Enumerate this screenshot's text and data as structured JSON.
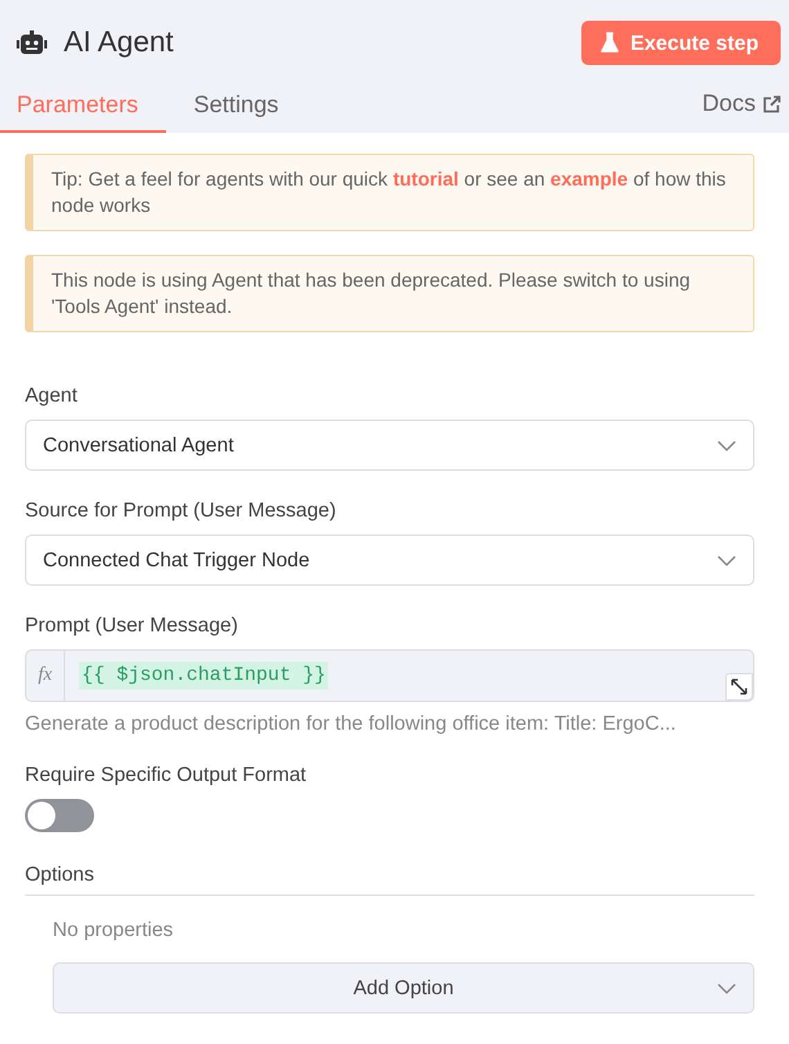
{
  "header": {
    "title": "AI Agent",
    "execute_button": "Execute step"
  },
  "tabs": [
    {
      "label": "Parameters",
      "selected": true
    },
    {
      "label": "Settings",
      "selected": false
    }
  ],
  "docs_link": "Docs",
  "notices": [
    {
      "parts": [
        {
          "text": "Tip: Get a feel for agents with our quick ",
          "link": false
        },
        {
          "text": "tutorial",
          "link": true
        },
        {
          "text": " or see an ",
          "link": false
        },
        {
          "text": "example",
          "link": true
        },
        {
          "text": " of how this node works",
          "link": false
        }
      ]
    },
    {
      "parts": [
        {
          "text": "This node is using Agent that has been deprecated. Please switch to using 'Tools Agent' instead.",
          "link": false
        }
      ]
    }
  ],
  "fields": [
    {
      "kind": "select",
      "label": "Agent",
      "value": "Conversational Agent"
    },
    {
      "kind": "select",
      "label": "Source for Prompt (User Message)",
      "value": "Connected Chat Trigger Node"
    },
    {
      "kind": "expression",
      "label": "Prompt (User Message)",
      "prefix": "fx",
      "value": "{{ $json.chatInput }}",
      "hint": "Generate a product description for the following office item: Title: ErgoC..."
    },
    {
      "kind": "toggle",
      "label": "Require Specific Output Format",
      "on": false
    }
  ],
  "options": {
    "label": "Options",
    "empty_text": "No properties",
    "add_button": "Add Option"
  }
}
